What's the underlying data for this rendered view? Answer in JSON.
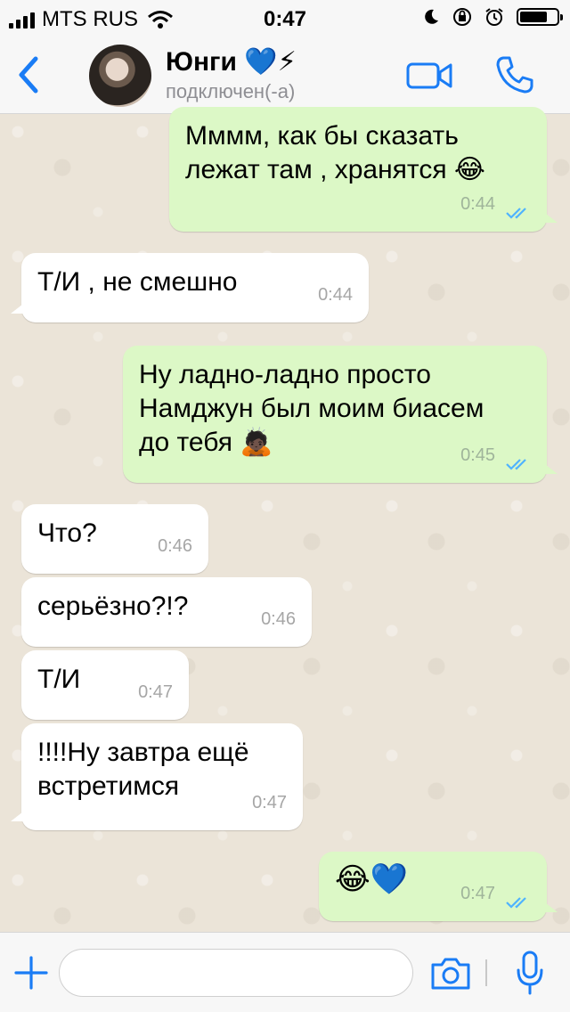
{
  "status_bar": {
    "carrier": "MTS RUS",
    "time": "0:47",
    "battery_level": 0.75
  },
  "header": {
    "contact_name": "Юнги",
    "name_emoji": "💙⚡",
    "contact_status": "подключен(-а)",
    "icons": [
      "back-chevron-icon",
      "avatar",
      "video-call-icon",
      "phone-icon"
    ],
    "accent_color": "#1a7cf5"
  },
  "messages": [
    {
      "direction": "out",
      "text_lines": [
        "Мммм, как бы сказать",
        "лежат там , хранятся 😂"
      ],
      "time": "0:44",
      "status": "read"
    },
    {
      "direction": "in",
      "text_lines": [
        "Т/И , не смешно"
      ],
      "time": "0:44"
    },
    {
      "direction": "out",
      "text_lines": [
        "Ну ладно-ладно просто",
        "Намджун был моим биасем",
        "до тебя 🙇🏿"
      ],
      "time": "0:45",
      "status": "read"
    },
    {
      "direction": "in",
      "text_lines": [
        "Что?"
      ],
      "time": "0:46"
    },
    {
      "direction": "in",
      "text_lines": [
        "серьёзно?!?"
      ],
      "time": "0:46"
    },
    {
      "direction": "in",
      "text_lines": [
        "Т/И"
      ],
      "time": "0:47"
    },
    {
      "direction": "in",
      "text_lines": [
        "!!!!Ну завтра ещё",
        "встретимся"
      ],
      "time": "0:47"
    },
    {
      "direction": "out",
      "text_lines": [
        "😂💙"
      ],
      "time": "0:47",
      "status": "read"
    }
  ],
  "input_bar": {
    "placeholder": "",
    "value": ""
  },
  "colors": {
    "incoming_bubble": "#ffffff",
    "outgoing_bubble": "#dcf8c6",
    "read_ticks": "#4fb3ff",
    "chat_background": "#ebe4d8"
  }
}
